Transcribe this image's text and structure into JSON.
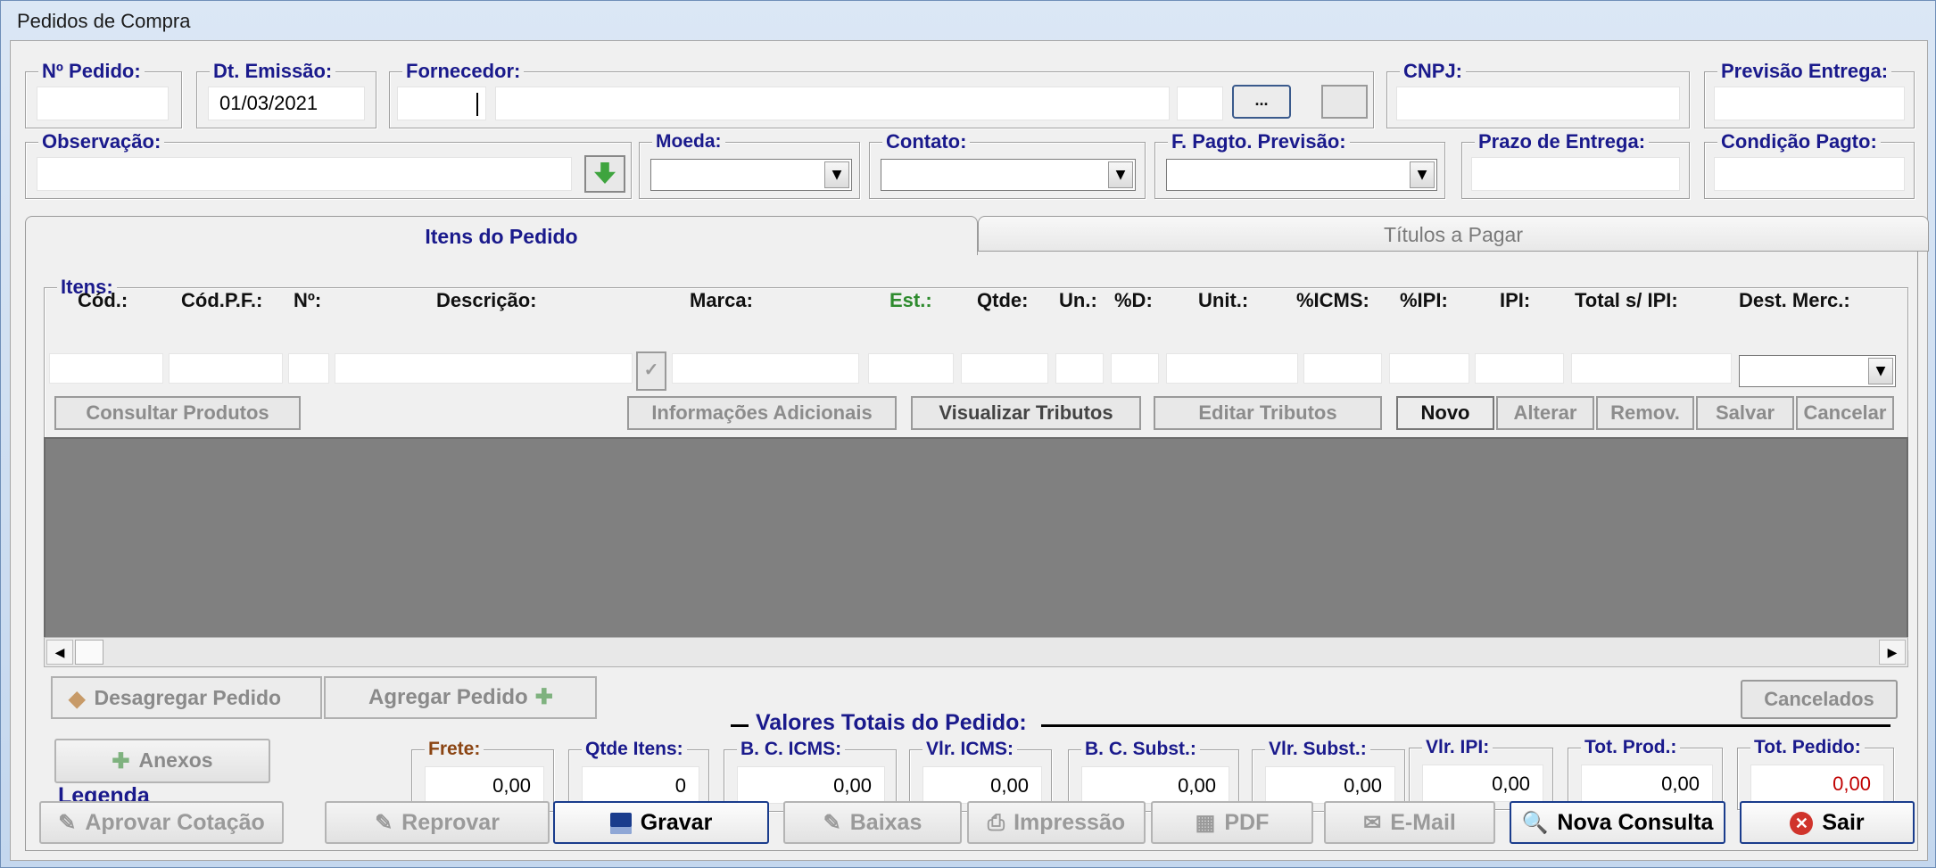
{
  "window": {
    "title": "Pedidos de Compra"
  },
  "header": {
    "pedido": {
      "label": "Nº Pedido:",
      "value": ""
    },
    "emissao": {
      "label": "Dt. Emissão:",
      "value": "01/03/2021"
    },
    "fornecedor": {
      "label": "Fornecedor:",
      "browse_label": "..."
    },
    "cnpj": {
      "label": "CNPJ:"
    },
    "previsao": {
      "label": "Previsão Entrega:"
    },
    "observacao": {
      "label": "Observação:"
    },
    "moeda": {
      "label": "Moeda:"
    },
    "contato": {
      "label": "Contato:"
    },
    "fpagto": {
      "label": "F. Pagto. Previsão:"
    },
    "prazo": {
      "label": "Prazo de Entrega:"
    },
    "condicao": {
      "label": "Condição Pagto:"
    }
  },
  "tabs": [
    {
      "label": "Itens do Pedido",
      "active": true
    },
    {
      "label": "Títulos a Pagar",
      "active": false
    }
  ],
  "itens": {
    "group_label": "Itens:",
    "columns": {
      "cod": "Cód.:",
      "codpf": "Cód.P.F.:",
      "no": "Nº:",
      "descricao": "Descrição:",
      "marca": "Marca:",
      "est": "Est.:",
      "qtde": "Qtde:",
      "un": "Un.:",
      "pd": "%D:",
      "unit": "Unit.:",
      "icms": "%ICMS:",
      "pipi": "%IPI:",
      "ipi": "IPI:",
      "total": "Total s/ IPI:",
      "dest": "Dest. Merc.:"
    },
    "est_color": "#2e8b2e",
    "buttons": {
      "consultar": "Consultar Produtos",
      "info": "Informações Adicionais",
      "visualizar": "Visualizar Tributos",
      "editar": "Editar Tributos",
      "novo": "Novo",
      "alterar": "Alterar",
      "remov": "Remov.",
      "salvar": "Salvar",
      "cancelar": "Cancelar"
    }
  },
  "grid": {
    "background": "#808080"
  },
  "agregacao": {
    "desagregar": "Desagregar Pedido",
    "agregar": "Agregar Pedido"
  },
  "cancelados_label": "Cancelados",
  "anexos_label": "Anexos",
  "legenda_label": "Legenda",
  "totais": {
    "title": "Valores Totais do Pedido:",
    "frete": {
      "label": "Frete:",
      "value": "0,00"
    },
    "qtde_itens": {
      "label": "Qtde Itens:",
      "value": "0"
    },
    "bc_icms": {
      "label": "B. C. ICMS:",
      "value": "0,00"
    },
    "vlr_icms": {
      "label": "Vlr. ICMS:",
      "value": "0,00"
    },
    "bc_subst": {
      "label": "B. C. Subst.:",
      "value": "0,00"
    },
    "vlr_subst": {
      "label": "Vlr. Subst.:",
      "value": "0,00"
    },
    "vlr_ipi": {
      "label": "Vlr. IPI:",
      "value": "0,00"
    },
    "tot_prod": {
      "label": "Tot. Prod.:",
      "value": "0,00"
    },
    "tot_pedido": {
      "label": "Tot. Pedido:",
      "value": "0,00"
    }
  },
  "footer": {
    "aprovar": "Aprovar Cotação",
    "reprovar": "Reprovar",
    "gravar": "Gravar",
    "baixas": "Baixas",
    "impressao": "Impressão",
    "pdf": "PDF",
    "email": "E-Mail",
    "nova_consulta": "Nova Consulta",
    "sair": "Sair"
  },
  "colors": {
    "label_blue": "#1a1a8c",
    "total_red": "#c00000",
    "focus_blue": "#1a3c8c"
  }
}
